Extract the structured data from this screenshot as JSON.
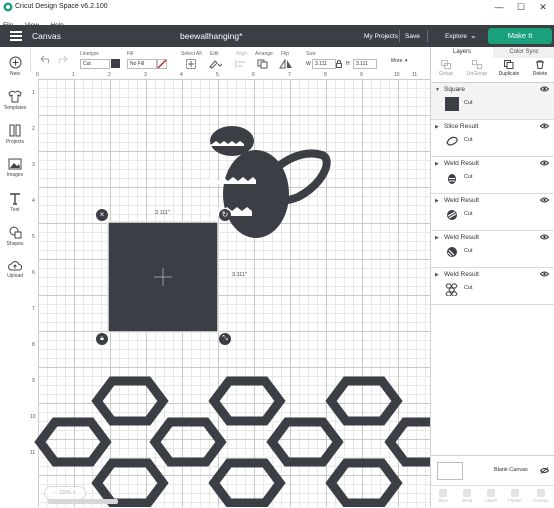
{
  "window": {
    "title": "Cricut Design Space  v6.2.100",
    "controls": [
      "—",
      "☐",
      "✕"
    ]
  },
  "menu": [
    "File",
    "View",
    "Help"
  ],
  "header": {
    "section": "Canvas",
    "document_title": "beewallhanging*",
    "my_projects": "My Projects",
    "save": "Save",
    "machine": "Explore",
    "make_it": "Make It",
    "accent_color": "#1aa07c"
  },
  "toolbar": {
    "linetype_label": "Linetype",
    "linetype_value": "Cut",
    "fill_label": "Fill",
    "fill_value": "No Fill",
    "select_all": "Select All",
    "edit": "Edit",
    "align": "Align",
    "arrange": "Arrange",
    "flip": "Flip",
    "size": "Size",
    "width_label": "W",
    "width_value": "3.111",
    "height_label": "H",
    "height_value": "3.111",
    "more": "More",
    "undo_icon": "undo-icon",
    "redo_icon": "redo-icon"
  },
  "sidebar": [
    {
      "label": "New",
      "icon": "plus-circle-icon"
    },
    {
      "label": "Templates",
      "icon": "shirt-icon"
    },
    {
      "label": "Projects",
      "icon": "projects-icon"
    },
    {
      "label": "Images",
      "icon": "image-icon"
    },
    {
      "label": "Text",
      "icon": "text-icon"
    },
    {
      "label": "Shapes",
      "icon": "shapes-icon"
    },
    {
      "label": "Upload",
      "icon": "upload-icon"
    }
  ],
  "canvas": {
    "ruler_h": [
      "0",
      "1",
      "2",
      "3",
      "4",
      "5",
      "6",
      "7",
      "8",
      "9",
      "10",
      "11"
    ],
    "ruler_v": [
      "1",
      "2",
      "3",
      "4",
      "5",
      "6",
      "7",
      "8",
      "9",
      "10",
      "11"
    ],
    "width_dim": "2.111\"",
    "height_dim": "3.111\""
  },
  "panel": {
    "tabs": [
      "Layers",
      "Color Sync"
    ],
    "actions": [
      "Group",
      "UnGroup",
      "Duplicate",
      "Delete"
    ],
    "layers": [
      {
        "name": "Square",
        "type": "Cut"
      },
      {
        "name": "Slice Result",
        "type": "Cut"
      },
      {
        "name": "Weld Result",
        "type": "Cut"
      },
      {
        "name": "Weld Result",
        "type": "Cut"
      },
      {
        "name": "Weld Result",
        "type": "Cut"
      },
      {
        "name": "Weld Result",
        "type": "Cut"
      }
    ],
    "blank_canvas": "Blank Canvas",
    "bottom_actions": [
      "Slice",
      "Weld",
      "Attach",
      "Flatten",
      "Contour"
    ]
  }
}
